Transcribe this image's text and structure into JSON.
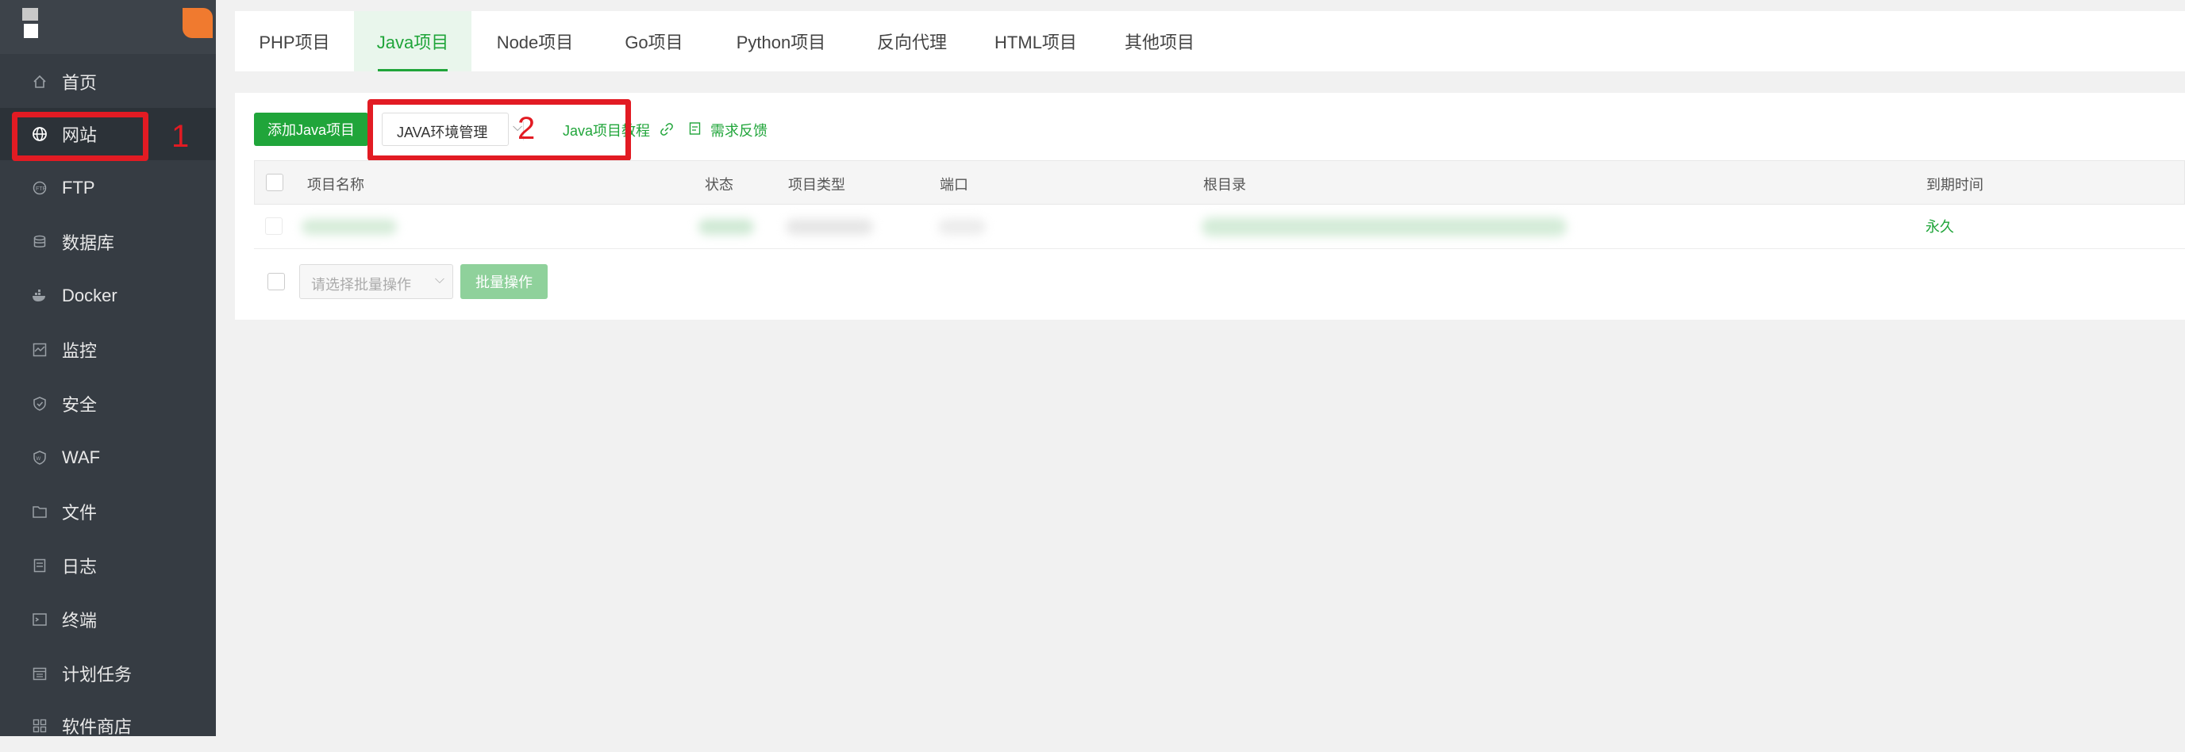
{
  "sidebar": {
    "items": [
      {
        "label": "首页",
        "icon": "home-icon"
      },
      {
        "label": "网站",
        "icon": "globe-icon"
      },
      {
        "label": "FTP",
        "icon": "ftp-icon"
      },
      {
        "label": "数据库",
        "icon": "database-icon"
      },
      {
        "label": "Docker",
        "icon": "docker-icon"
      },
      {
        "label": "监控",
        "icon": "monitor-icon"
      },
      {
        "label": "安全",
        "icon": "shield-icon"
      },
      {
        "label": "WAF",
        "icon": "waf-icon"
      },
      {
        "label": "文件",
        "icon": "folder-icon"
      },
      {
        "label": "日志",
        "icon": "log-icon"
      },
      {
        "label": "终端",
        "icon": "terminal-icon"
      },
      {
        "label": "计划任务",
        "icon": "calendar-icon"
      },
      {
        "label": "软件商店",
        "icon": "apps-icon"
      }
    ],
    "active_index": 1
  },
  "annotations": {
    "label_1": "1",
    "label_2": "2",
    "color": "#e21b23"
  },
  "tabs": [
    {
      "label": "PHP项目"
    },
    {
      "label": "Java项目"
    },
    {
      "label": "Node项目"
    },
    {
      "label": "Go项目"
    },
    {
      "label": "Python项目"
    },
    {
      "label": "反向代理"
    },
    {
      "label": "HTML项目"
    },
    {
      "label": "其他项目"
    }
  ],
  "active_tab": "Java项目",
  "toolbar": {
    "add_button": "添加Java项目",
    "env_select": "JAVA环境管理",
    "tutorial_link": "Java项目教程",
    "feedback_link": "需求反馈"
  },
  "table": {
    "columns": [
      "项目名称",
      "状态",
      "项目类型",
      "端口",
      "根目录",
      "到期时间"
    ],
    "rows": [
      {
        "expiry": "永久"
      }
    ]
  },
  "batch": {
    "placeholder": "请选择批量操作",
    "button": "批量操作"
  },
  "colors": {
    "accent": "#20a53a",
    "sidebar_bg": "#363c43",
    "highlight": "#e21b23"
  }
}
